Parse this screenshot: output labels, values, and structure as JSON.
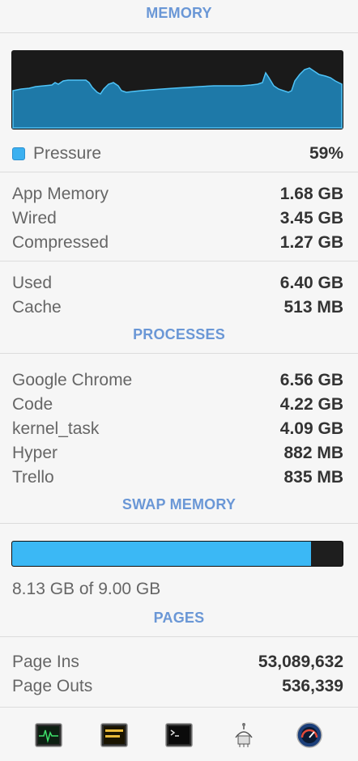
{
  "memory": {
    "header": "MEMORY",
    "pressure": {
      "label": "Pressure",
      "value": "59%"
    },
    "rows1": [
      {
        "label": "App Memory",
        "value": "1.68 GB"
      },
      {
        "label": "Wired",
        "value": "3.45 GB"
      },
      {
        "label": "Compressed",
        "value": "1.27 GB"
      }
    ],
    "rows2": [
      {
        "label": "Used",
        "value": "6.40 GB"
      },
      {
        "label": "Cache",
        "value": "513 MB"
      }
    ]
  },
  "processes": {
    "header": "PROCESSES",
    "items": [
      {
        "label": "Google Chrome",
        "value": "6.56 GB"
      },
      {
        "label": "Code",
        "value": "4.22 GB"
      },
      {
        "label": "kernel_task",
        "value": "4.09 GB"
      },
      {
        "label": "Hyper",
        "value": "882 MB"
      },
      {
        "label": "Trello",
        "value": "835 MB"
      }
    ]
  },
  "swap": {
    "header": "SWAP MEMORY",
    "fraction": 0.9033,
    "text": "8.13 GB of 9.00 GB"
  },
  "pages": {
    "header": "PAGES",
    "rows": [
      {
        "label": "Page Ins",
        "value": "53,089,632"
      },
      {
        "label": "Page Outs",
        "value": "536,339"
      }
    ]
  },
  "dock": {
    "icons": [
      "activity-monitor-icon",
      "console-icon",
      "terminal-icon",
      "system-information-icon",
      "disk-utility-icon"
    ]
  },
  "colors": {
    "accent": "#6a97d6",
    "graph_fill": "#1e79a8",
    "graph_line": "#4fc3f7",
    "swap_fill": "#3bb8f5"
  }
}
